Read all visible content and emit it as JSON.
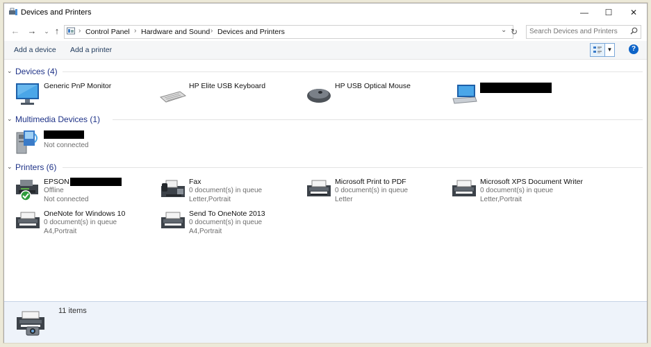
{
  "window": {
    "title": "Devices and Printers",
    "minimize": "—",
    "maximize": "☐",
    "close": "✕"
  },
  "nav": {
    "back": "←",
    "forward": "→",
    "recent": "⌄",
    "up": "↑",
    "refresh": "↻",
    "dropdown": "⌄"
  },
  "address": {
    "segments": [
      "Control Panel",
      "Hardware and Sound",
      "Devices and Printers"
    ],
    "separator": "›"
  },
  "search": {
    "placeholder": "Search Devices and Printers"
  },
  "toolbar": {
    "add_device": "Add a device",
    "add_printer": "Add a printer",
    "help": "?"
  },
  "groups": {
    "devices": {
      "title": "Devices (4)",
      "items": [
        {
          "name": "Generic PnP Monitor",
          "icon": "monitor-icon"
        },
        {
          "name": "HP Elite USB Keyboard",
          "icon": "keyboard-icon"
        },
        {
          "name": "HP USB Optical Mouse",
          "icon": "mouse-icon"
        },
        {
          "name": "",
          "icon": "laptop-icon",
          "redacted": true
        }
      ]
    },
    "multimedia": {
      "title": "Multimedia Devices (1)",
      "items": [
        {
          "name": "",
          "status": "Not connected",
          "icon": "media-device-icon",
          "redacted": true
        }
      ]
    },
    "printers": {
      "title": "Printers (6)",
      "items": [
        {
          "name": "EPSON",
          "l2": "Offline",
          "l3": "Not connected",
          "icon": "default-printer-icon"
        },
        {
          "name": "Fax",
          "l2": "0 document(s) in queue",
          "l3": "Letter,Portrait",
          "icon": "fax-icon"
        },
        {
          "name": "Microsoft Print to PDF",
          "l2": "0 document(s) in queue",
          "l3": "Letter",
          "icon": "printer-icon"
        },
        {
          "name": "Microsoft XPS Document Writer",
          "l2": "0 document(s) in queue",
          "l3": "Letter,Portrait",
          "icon": "printer-icon"
        },
        {
          "name": "OneNote for Windows 10",
          "l2": "0 document(s) in queue",
          "l3": "A4,Portrait",
          "icon": "printer-icon"
        },
        {
          "name": "Send To OneNote 2013",
          "l2": "0 document(s) in queue",
          "l3": "A4,Portrait",
          "icon": "printer-icon"
        }
      ]
    }
  },
  "details": {
    "count": "11 items",
    "icon": "camera-printer-icon"
  },
  "colors": {
    "accent": "#0e64c8",
    "group_title": "#1e3287",
    "details_bg": "#eef3fa"
  }
}
